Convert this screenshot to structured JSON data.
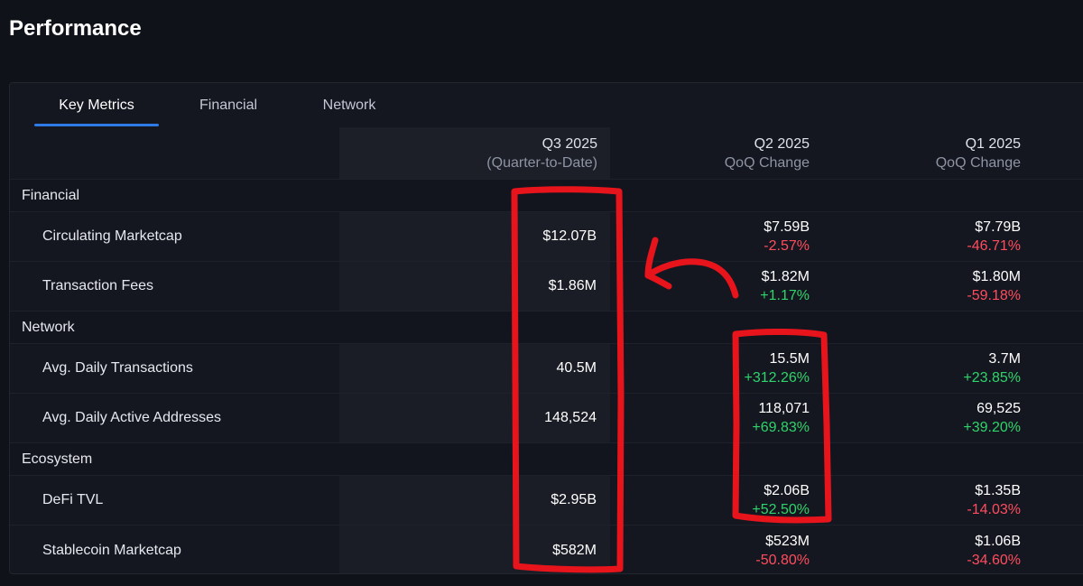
{
  "page": {
    "title": "Performance"
  },
  "tabs": [
    {
      "label": "Key Metrics",
      "active": true
    },
    {
      "label": "Financial",
      "active": false
    },
    {
      "label": "Network",
      "active": false
    }
  ],
  "columns": {
    "q3": {
      "title": "Q3 2025",
      "subtitle": "(Quarter-to-Date)"
    },
    "q2": {
      "title": "Q2 2025",
      "subtitle": "QoQ Change"
    },
    "q1": {
      "title": "Q1 2025",
      "subtitle": "QoQ Change"
    }
  },
  "sections": {
    "financial": "Financial",
    "network": "Network",
    "ecosystem": "Ecosystem"
  },
  "rows": {
    "circulating_marketcap": {
      "label": "Circulating Marketcap",
      "q3": "$12.07B",
      "q2": "$7.59B",
      "q2_change": "-2.57%",
      "q1": "$7.79B",
      "q1_change": "-46.71%"
    },
    "transaction_fees": {
      "label": "Transaction Fees",
      "q3": "$1.86M",
      "q2": "$1.82M",
      "q2_change": "+1.17%",
      "q1": "$1.80M",
      "q1_change": "-59.18%"
    },
    "avg_daily_transactions": {
      "label": "Avg. Daily Transactions",
      "q3": "40.5M",
      "q2": "15.5M",
      "q2_change": "+312.26%",
      "q1": "3.7M",
      "q1_change": "+23.85%"
    },
    "avg_daily_active_addresses": {
      "label": "Avg. Daily Active Addresses",
      "q3": "148,524",
      "q2": "118,071",
      "q2_change": "+69.83%",
      "q1": "69,525",
      "q1_change": "+39.20%"
    },
    "defi_tvl": {
      "label": "DeFi TVL",
      "q3": "$2.95B",
      "q2": "$2.06B",
      "q2_change": "+52.50%",
      "q1": "$1.35B",
      "q1_change": "-14.03%"
    },
    "stablecoin_marketcap": {
      "label": "Stablecoin Marketcap",
      "q3": "$582M",
      "q2": "$523M",
      "q2_change": "-50.80%",
      "q1": "$1.06B",
      "q1_change": "-34.60%"
    }
  },
  "colors": {
    "background": "#10121a",
    "card": "#141720",
    "accent": "#2f7be5",
    "positive": "#2fd46b",
    "negative": "#ff4d5e",
    "annotation": "#e8141c"
  }
}
